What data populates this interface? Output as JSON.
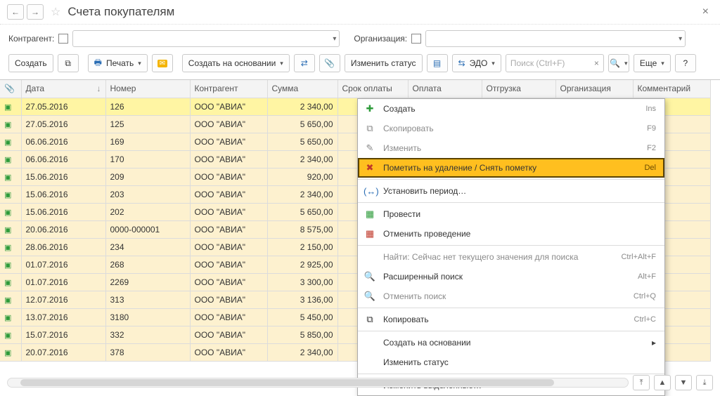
{
  "title": "Счета покупателям",
  "filters": {
    "contragent_label": "Контрагент:",
    "org_label": "Организация:"
  },
  "toolbar": {
    "create": "Создать",
    "print": "Печать",
    "create_based": "Создать на основании",
    "change_status": "Изменить статус",
    "edo": "ЭДО",
    "search_placeholder": "Поиск (Ctrl+F)",
    "more": "Еще"
  },
  "columns": {
    "clip": "",
    "date": "Дата",
    "number": "Номер",
    "contragent": "Контрагент",
    "sum": "Сумма",
    "due": "Срок оплаты",
    "pay": "Оплата",
    "ship": "Отгрузка",
    "org": "Организация",
    "comment": "Комментарий"
  },
  "rows": [
    {
      "date": "27.05.2016",
      "num": "126",
      "ca": "ООО \"АВИА\"",
      "sum": "2 340,00",
      "sel": true
    },
    {
      "date": "27.05.2016",
      "num": "125",
      "ca": "ООО \"АВИА\"",
      "sum": "5 650,00"
    },
    {
      "date": "06.06.2016",
      "num": "169",
      "ca": "ООО \"АВИА\"",
      "sum": "5 650,00"
    },
    {
      "date": "06.06.2016",
      "num": "170",
      "ca": "ООО \"АВИА\"",
      "sum": "2 340,00"
    },
    {
      "date": "15.06.2016",
      "num": "209",
      "ca": "ООО \"АВИА\"",
      "sum": "920,00"
    },
    {
      "date": "15.06.2016",
      "num": "203",
      "ca": "ООО \"АВИА\"",
      "sum": "2 340,00"
    },
    {
      "date": "15.06.2016",
      "num": "202",
      "ca": "ООО \"АВИА\"",
      "sum": "5 650,00"
    },
    {
      "date": "20.06.2016",
      "num": "0000-000001",
      "ca": "ООО \"АВИА\"",
      "sum": "8 575,00"
    },
    {
      "date": "28.06.2016",
      "num": "234",
      "ca": "ООО \"АВИА\"",
      "sum": "2 150,00"
    },
    {
      "date": "01.07.2016",
      "num": "268",
      "ca": "ООО \"АВИА\"",
      "sum": "2 925,00"
    },
    {
      "date": "01.07.2016",
      "num": "2269",
      "ca": "ООО \"АВИА\"",
      "sum": "3 300,00"
    },
    {
      "date": "12.07.2016",
      "num": "313",
      "ca": "ООО \"АВИА\"",
      "sum": "3 136,00"
    },
    {
      "date": "13.07.2016",
      "num": "3180",
      "ca": "ООО \"АВИА\"",
      "sum": "5 450,00"
    },
    {
      "date": "15.07.2016",
      "num": "332",
      "ca": "ООО \"АВИА\"",
      "sum": "5 850,00"
    },
    {
      "date": "20.07.2016",
      "num": "378",
      "ca": "ООО \"АВИА\"",
      "sum": "2 340,00"
    }
  ],
  "ctx": {
    "create": {
      "label": "Создать",
      "short": "Ins"
    },
    "copy": {
      "label": "Скопировать",
      "short": "F9"
    },
    "edit": {
      "label": "Изменить",
      "short": "F2"
    },
    "markdel": {
      "label": "Пометить на удаление / Снять пометку",
      "short": "Del"
    },
    "period": {
      "label": "Установить период…"
    },
    "post": {
      "label": "Провести"
    },
    "unpost": {
      "label": "Отменить проведение"
    },
    "find": {
      "label": "Найти: Сейчас нет текущего значения для поиска",
      "short": "Ctrl+Alt+F"
    },
    "advfind": {
      "label": "Расширенный поиск",
      "short": "Alt+F"
    },
    "cancelfind": {
      "label": "Отменить поиск",
      "short": "Ctrl+Q"
    },
    "copyclip": {
      "label": "Копировать",
      "short": "Ctrl+C"
    },
    "createbased": {
      "label": "Создать на основании"
    },
    "chstatus": {
      "label": "Изменить статус"
    },
    "chselected": {
      "label": "Изменить выделенные…"
    }
  }
}
